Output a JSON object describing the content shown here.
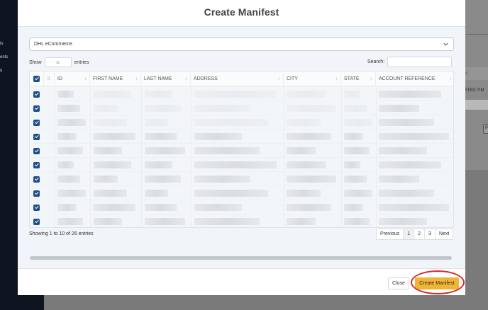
{
  "background": {
    "sidebar_items": [
      "ts",
      "ents",
      "s"
    ],
    "right_fragments": [
      "s:",
      "ATED TIM",
      "P"
    ]
  },
  "modal": {
    "title": "Create Manifest",
    "carrier_select": {
      "value": "DHL eCommerce"
    },
    "length": {
      "prefix": "Show",
      "value": "10",
      "suffix": "entries"
    },
    "search": {
      "label": "Search:",
      "value": ""
    },
    "table": {
      "columns": [
        "ID",
        "FIRST NAME",
        "LAST NAME",
        "ADDRESS",
        "CITY",
        "STATE",
        "ACCOUNT REFERENCE"
      ],
      "rows_checked": [
        true,
        true,
        true,
        true,
        true,
        true,
        true,
        true,
        true,
        true
      ]
    },
    "info": "Showing 1 to 10 of 26 entries",
    "pagination": [
      "Previous",
      "1",
      "2",
      "3",
      "Next"
    ],
    "active_page": "1",
    "footer": {
      "close_label": "Close",
      "create_label": "Create Manifest"
    }
  },
  "colors": {
    "accent": "#f0b436",
    "checkbox": "#1f4e8c",
    "highlight": "#d6282e"
  }
}
